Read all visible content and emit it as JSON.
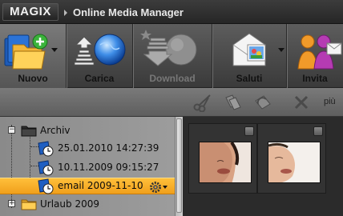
{
  "titlebar": {
    "logo": "MAGIX",
    "title": "Online Media Manager"
  },
  "toolbar": {
    "buttons": [
      {
        "label": "Nuovo",
        "icon": "new-folder-icon"
      },
      {
        "label": "Carica",
        "icon": "upload-globe-icon"
      },
      {
        "label": "Download",
        "icon": "download-globe-icon",
        "disabled": true
      },
      {
        "label": "Saluti",
        "icon": "greeting-envelope-icon"
      },
      {
        "label": "Invita",
        "icon": "invite-people-icon"
      }
    ]
  },
  "subbar": {
    "more_label": "più"
  },
  "tree": {
    "items": [
      {
        "label": "Archiv",
        "type": "folder"
      },
      {
        "label": "25.01.2010 14:27:39",
        "type": "album"
      },
      {
        "label": "10.11.2009 09:15:27",
        "type": "album"
      },
      {
        "label": "email 2009-11-10",
        "type": "album",
        "selected": true
      },
      {
        "label": "Urlaub 2009",
        "type": "folder"
      }
    ]
  },
  "colors": {
    "selection": "#f0a01c",
    "accent_green": "#3bb33b"
  }
}
